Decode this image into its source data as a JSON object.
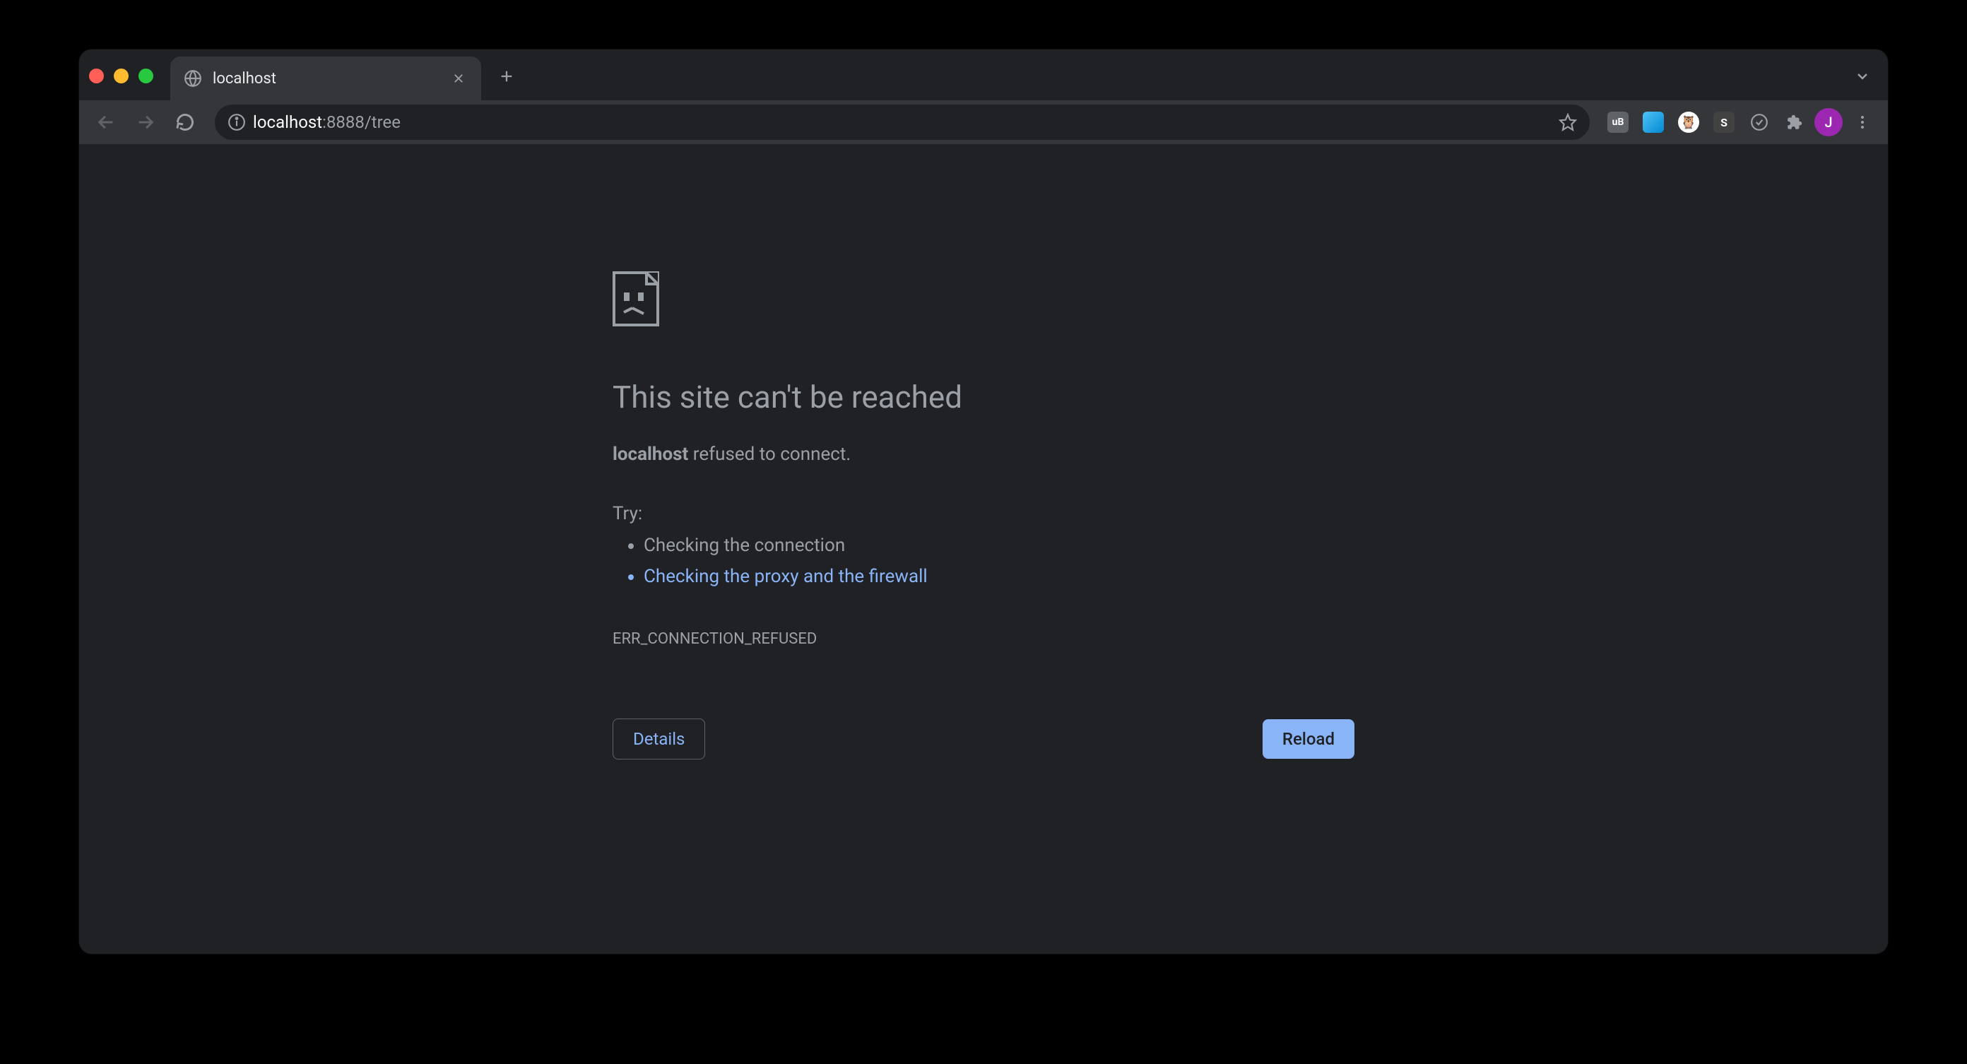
{
  "tab": {
    "title": "localhost"
  },
  "url": {
    "host": "localhost",
    "rest": ":8888/tree"
  },
  "error": {
    "heading": "This site can't be reached",
    "host": "localhost",
    "refused_text": " refused to connect.",
    "try_label": "Try:",
    "suggestions": [
      "Checking the connection",
      "Checking the proxy and the firewall"
    ],
    "code": "ERR_CONNECTION_REFUSED",
    "details_label": "Details",
    "reload_label": "Reload"
  },
  "profile": {
    "initial": "J"
  },
  "extensions": {
    "ublock": "uB",
    "s_ext": "S"
  }
}
